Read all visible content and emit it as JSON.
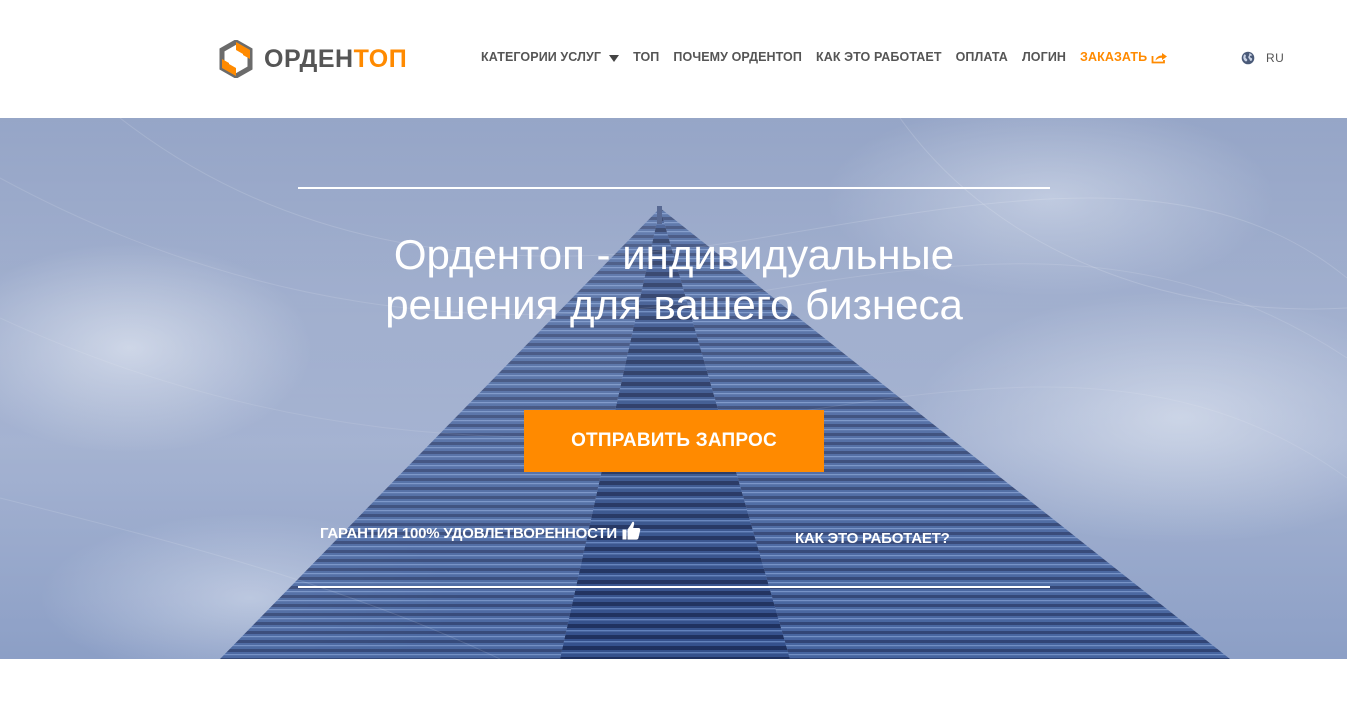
{
  "header": {
    "logo": {
      "part1": "ОРДЕН",
      "part2": "ТОП",
      "icon": "hexagon-logo-icon"
    },
    "nav": {
      "items": [
        {
          "label": "КАТЕГОРИИ УСЛУГ",
          "has_dropdown": true
        },
        {
          "label": "ТОП"
        },
        {
          "label": "ПОЧЕМУ ОРДЕНТОП"
        },
        {
          "label": "КАК ЭТО РАБОТАЕТ"
        },
        {
          "label": "ОПЛАТА"
        },
        {
          "label": "ЛОГИН"
        }
      ],
      "order": {
        "label": "ЗАКАЗАТЬ",
        "icon": "share-icon"
      }
    },
    "language": {
      "label": "RU",
      "icon": "globe-icon"
    }
  },
  "hero": {
    "title_line1": "Ордентоп - индивидуальные",
    "title_line2": "решения для вашего бизнеса",
    "cta_label": "ОТПРАВИТЬ ЗАПРОС",
    "guarantee_label": "ГАРАНТИЯ 100% УДОВЛЕТВОРЕННОСТИ",
    "guarantee_icon": "thumbs-up-icon",
    "how_it_works_label": "КАК ЭТО РАБОТАЕТ?",
    "background": "skyscraper-photo"
  },
  "colors": {
    "accent": "#ff8a00",
    "nav_text": "#555555",
    "hero_text": "#ffffff"
  }
}
